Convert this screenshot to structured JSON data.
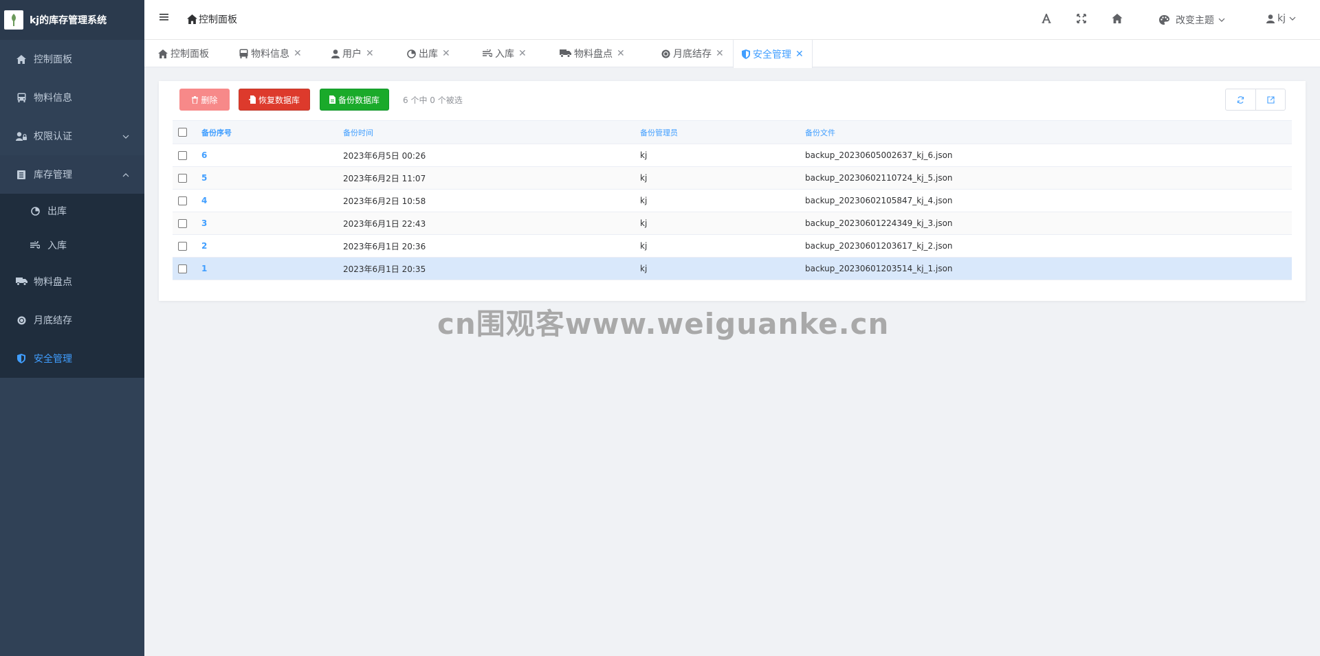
{
  "app": {
    "title": "kj的库存管理系统"
  },
  "sidebar": {
    "items": [
      {
        "label": "控制面板",
        "icon": "home-icon"
      },
      {
        "label": "物料信息",
        "icon": "bus-icon"
      },
      {
        "label": "权限认证",
        "icon": "user-lock-icon"
      },
      {
        "label": "库存管理",
        "icon": "list-icon"
      },
      {
        "label": "出库",
        "icon": "pie-icon"
      },
      {
        "label": "入库",
        "icon": "wind-icon"
      },
      {
        "label": "物料盘点",
        "icon": "truck-icon"
      },
      {
        "label": "月底结存",
        "icon": "coin-icon"
      },
      {
        "label": "安全管理",
        "icon": "shield-icon"
      }
    ]
  },
  "header": {
    "breadcrumb": "控制面板",
    "theme_label": "改变主题",
    "user_label": "kj"
  },
  "tabs": [
    {
      "label": "控制面板"
    },
    {
      "label": "物料信息"
    },
    {
      "label": "用户"
    },
    {
      "label": "出库"
    },
    {
      "label": "入库"
    },
    {
      "label": "物料盘点"
    },
    {
      "label": "月底结存"
    },
    {
      "label": "安全管理"
    }
  ],
  "toolbar": {
    "delete_label": "删除",
    "restore_label": "恢复数据库",
    "backup_label": "备份数据库",
    "selection_info": "6 个中 0 个被选"
  },
  "table": {
    "headers": [
      "备份序号",
      "备份时间",
      "备份管理员",
      "备份文件"
    ],
    "rows": [
      {
        "id": "6",
        "time": "2023年6月5日 00:26",
        "admin": "kj",
        "file": "backup_20230605002637_kj_6.json"
      },
      {
        "id": "5",
        "time": "2023年6月2日 11:07",
        "admin": "kj",
        "file": "backup_20230602110724_kj_5.json"
      },
      {
        "id": "4",
        "time": "2023年6月2日 10:58",
        "admin": "kj",
        "file": "backup_20230602105847_kj_4.json"
      },
      {
        "id": "3",
        "time": "2023年6月1日 22:43",
        "admin": "kj",
        "file": "backup_20230601224349_kj_3.json"
      },
      {
        "id": "2",
        "time": "2023年6月1日 20:36",
        "admin": "kj",
        "file": "backup_20230601203617_kj_2.json"
      },
      {
        "id": "1",
        "time": "2023年6月1日 20:35",
        "admin": "kj",
        "file": "backup_20230601203514_kj_1.json"
      }
    ]
  },
  "watermark": "cn围观客www.weiguanke.cn",
  "colors": {
    "sidebar_bg": "#304156",
    "accent": "#409eff",
    "danger": "#dd3a2c",
    "success": "#1aaa2a"
  }
}
